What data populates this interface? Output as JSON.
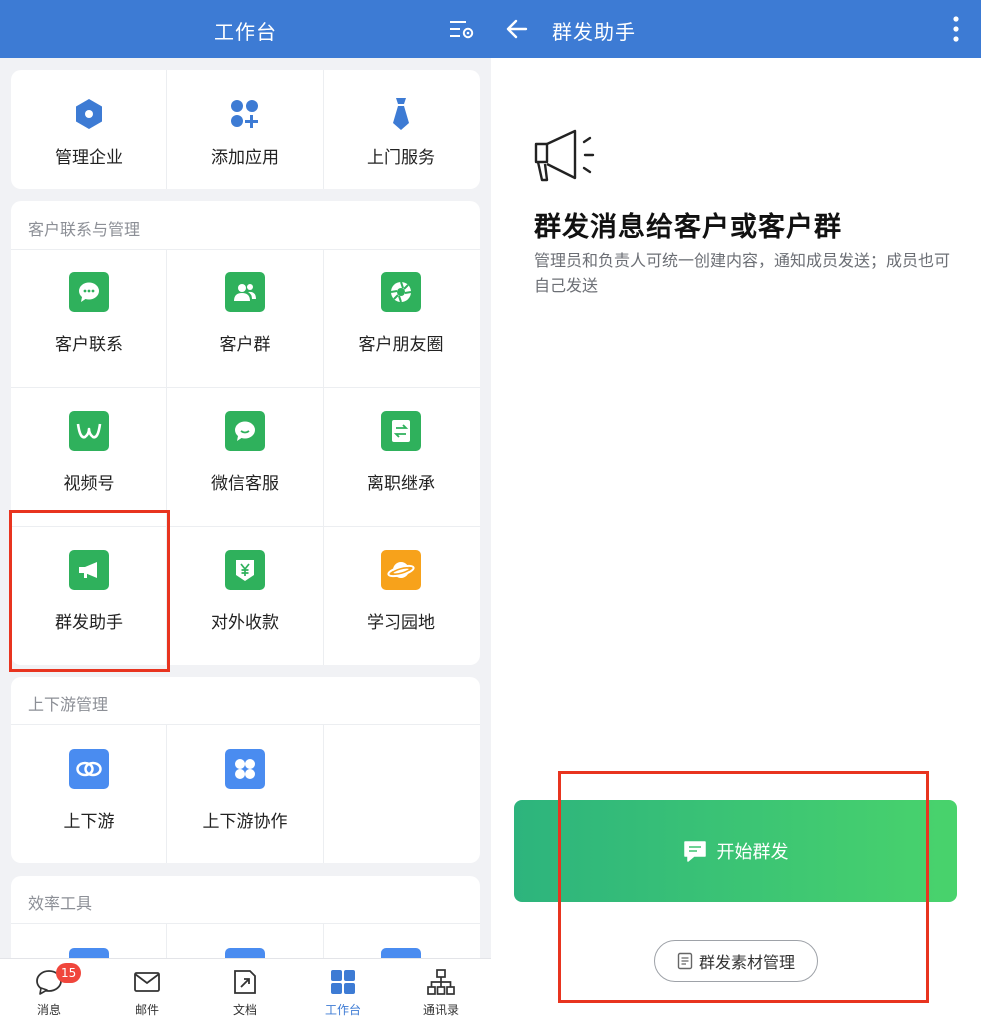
{
  "left": {
    "header": {
      "title": "工作台"
    },
    "top_actions": [
      {
        "label": "管理企业",
        "icon": "hexagon-icon"
      },
      {
        "label": "添加应用",
        "icon": "apps-add-icon"
      },
      {
        "label": "上门服务",
        "icon": "tie-icon"
      }
    ],
    "customer_section": {
      "title": "客户联系与管理",
      "items": [
        {
          "label": "客户联系",
          "icon": "chat-bubble-icon"
        },
        {
          "label": "客户群",
          "icon": "group-icon"
        },
        {
          "label": "客户朋友圈",
          "icon": "aperture-icon"
        },
        {
          "label": "视频号",
          "icon": "channels-icon"
        },
        {
          "label": "微信客服",
          "icon": "service-chat-icon"
        },
        {
          "label": "离职继承",
          "icon": "transfer-icon"
        },
        {
          "label": "群发助手",
          "icon": "megaphone-icon"
        },
        {
          "label": "对外收款",
          "icon": "yuan-icon"
        },
        {
          "label": "学习园地",
          "icon": "planet-icon"
        }
      ]
    },
    "updown_section": {
      "title": "上下游管理",
      "items": [
        {
          "label": "上下游",
          "icon": "link-rings-icon"
        },
        {
          "label": "上下游协作",
          "icon": "four-circles-icon"
        }
      ]
    },
    "efficiency_section": {
      "title": "效率工具"
    },
    "bottom_nav": [
      {
        "label": "消息",
        "badge": "15",
        "icon": "message-icon"
      },
      {
        "label": "邮件",
        "icon": "mail-icon"
      },
      {
        "label": "文档",
        "icon": "document-icon"
      },
      {
        "label": "工作台",
        "icon": "workbench-icon",
        "active": true
      },
      {
        "label": "通讯录",
        "icon": "contacts-icon"
      }
    ],
    "accent_color": "#3d7bd4"
  },
  "right": {
    "header": {
      "title": "群发助手"
    },
    "hero": {
      "title": "群发消息给客户或客户群",
      "description": "管理员和负责人可统一创建内容，通知成员发送；成员也可自己发送"
    },
    "start_button": "开始群发",
    "material_button": "群发素材管理",
    "highlight_color": "#e8341f"
  }
}
